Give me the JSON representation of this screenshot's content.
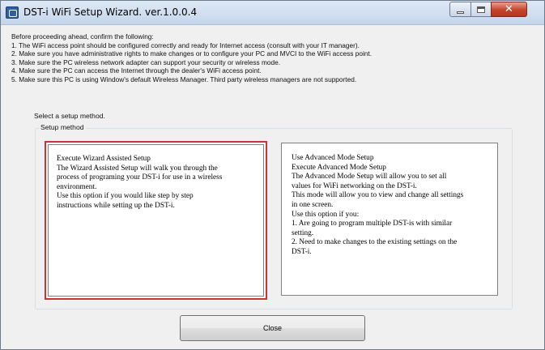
{
  "window": {
    "title": "DST-i WiFi Setup Wizard. ver.1.0.0.4",
    "controls": {
      "minimize": "minimize-icon",
      "maximize": "maximize-icon",
      "close": "close-icon",
      "close_glyph": "✕"
    }
  },
  "instructions": {
    "intro": "Before proceeding ahead, confirm the following:",
    "items": [
      "1. The WiFi access point should be configured correctly and ready for Internet access (consult with your IT manager).",
      "2. Make sure you have administrative rights to make changes or to configure your PC and MVCI to the WiFi access point.",
      "3. Make sure the PC wireless network adapter can support your security or wireless mode.",
      "4. Make sure the PC can access the Internet through the dealer's WiFi access point.",
      "5. Make sure this PC is using Window's default Wireless Manager. Third party wireless managers are not supported."
    ]
  },
  "setup": {
    "select_label": "Select a setup method.",
    "group_label": "Setup method",
    "wizard": {
      "selected": true,
      "lines": [
        "Execute Wizard Assisted Setup",
        "The Wizard Assisted Setup will walk you through the",
        "process of programing your DST-i for use in a wireless",
        "environment.",
        "Use this option if you would like step by step",
        "instructions while setting up the DST-i."
      ]
    },
    "advanced": {
      "selected": false,
      "lines": [
        "Use Advanced Mode Setup",
        "Execute Advanced Mode Setup",
        "The Advanced Mode Setup will allow you to set all",
        "values for WiFi networking on the DST-i.",
        "This mode will allow you to view and change all settings",
        "in one screen.",
        "Use this option if you:",
        "1. Are going to program multiple DST-is with similar",
        "setting.",
        "2. Need to make changes to the existing settings on the",
        "DST-i."
      ]
    }
  },
  "footer": {
    "close_label": "Close"
  },
  "colors": {
    "selection_border": "#c7343a",
    "window_background": "#f0f0f0",
    "titlebar_gradient_top": "#dfe9f5",
    "close_button_red": "#c4432b"
  }
}
